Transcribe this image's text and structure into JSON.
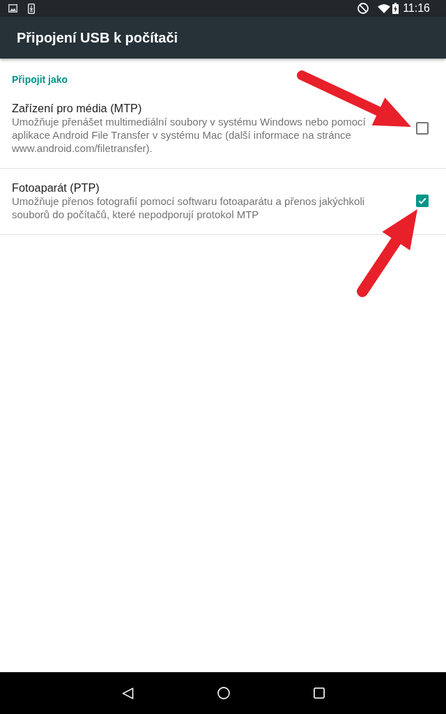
{
  "status_bar": {
    "time": "11:16"
  },
  "app_bar": {
    "title": "Připojení USB k počítači"
  },
  "category": {
    "title": "Připojit jako"
  },
  "options": [
    {
      "title": "Zařízení pro média (MTP)",
      "summary": "Umožňuje přenášet multimediální soubory v systému Windows nebo pomocí aplikace Android File Transfer v systému Mac (další informace na stránce www.android.com/filetransfer).",
      "checked": false,
      "arrow": {
        "kind": "downward"
      }
    },
    {
      "title": "Fotoaparát (PTP)",
      "summary": "Umožňuje přenos fotografií pomocí softwaru fotoaparátu a přenos jakýchkoli souborů do počítačů, které nepodporují protokol MTP",
      "checked": true,
      "arrow": {
        "kind": "upward"
      }
    }
  ]
}
